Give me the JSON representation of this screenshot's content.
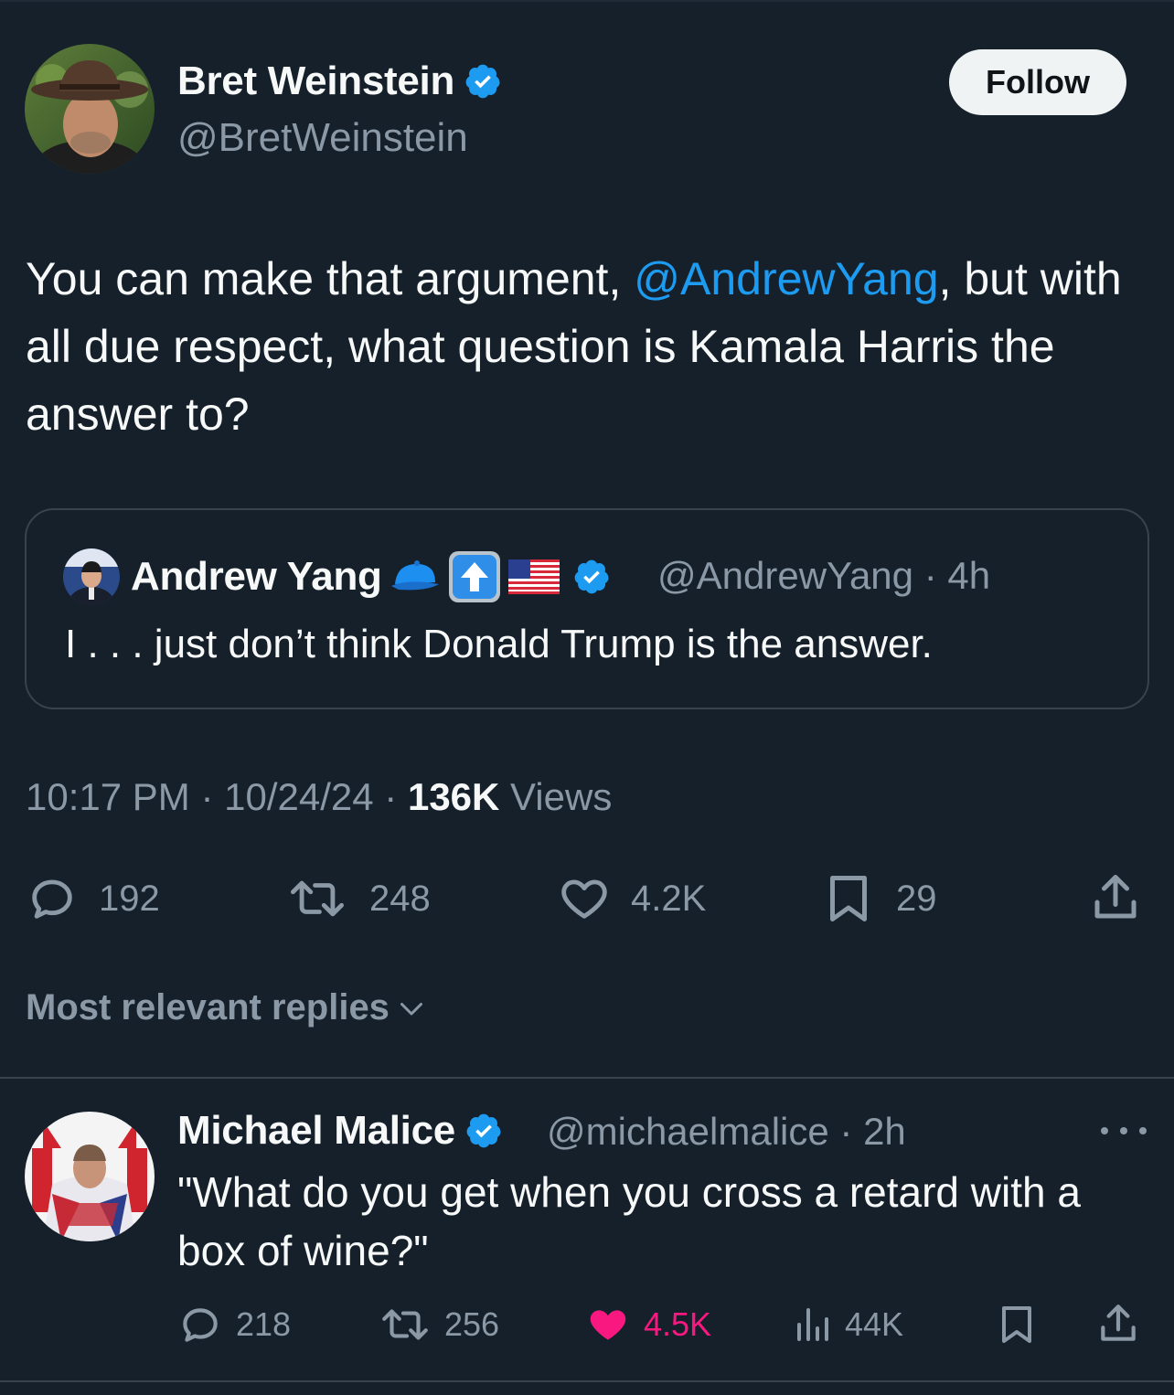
{
  "tweet": {
    "author_name": "Bret Weinstein",
    "author_handle": "@BretWeinstein",
    "follow_label": "Follow",
    "text_before": "You can make that argument, ",
    "mention": "@AndrewYang",
    "text_after": ", but with all due respect, what question is Kamala Harris the answer to?",
    "time": "10:17 PM",
    "sep": "·",
    "date": "10/24/24",
    "views_count": "136K",
    "views_label": "Views",
    "replies": "192",
    "reposts": "248",
    "likes": "4.2K",
    "bookmarks": "29"
  },
  "quote": {
    "author_name": "Andrew Yang",
    "author_handle": "@AndrewYang",
    "time_ago": "4h",
    "sep": "·",
    "text": "I . . . just don’t think Donald Trump is the answer."
  },
  "replies_sort": {
    "label": "Most relevant replies"
  },
  "reply": {
    "author_name": "Michael Malice",
    "author_handle": "@michaelmalice",
    "time_ago": "2h",
    "sep": "·",
    "text": "\"What do you get when you cross a retard with a box of wine?\"",
    "replies": "218",
    "reposts": "256",
    "likes": "4.5K",
    "views": "44K"
  },
  "colors": {
    "background": "#15202b",
    "accent": "#1d9bf0",
    "muted": "#8b98a5",
    "like_active": "#f91880"
  },
  "icons": {
    "verified": "verified-badge-icon",
    "reply": "reply-icon",
    "repost": "repost-icon",
    "like": "heart-icon",
    "bookmark": "bookmark-icon",
    "share": "share-icon",
    "views": "views-icon",
    "more": "more-icon",
    "chevron": "chevron-down-icon"
  }
}
